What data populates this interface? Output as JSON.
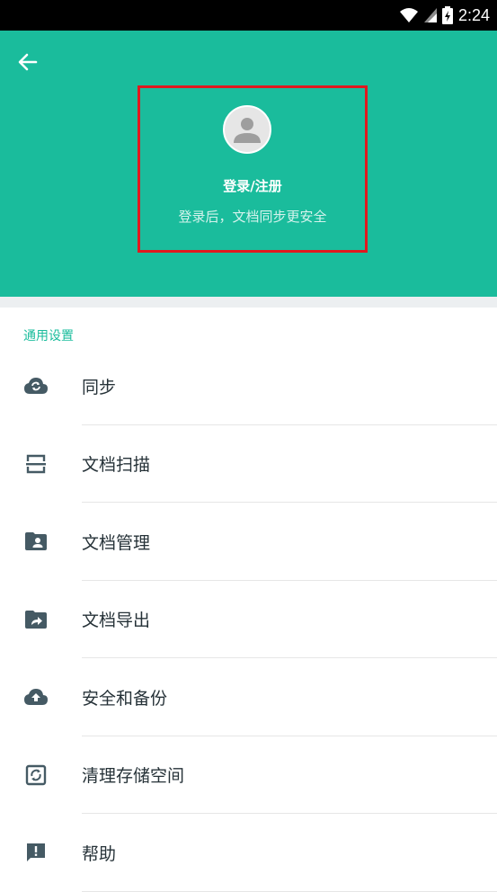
{
  "status_bar": {
    "time": "2:24"
  },
  "header": {
    "login_title": "登录/注册",
    "login_subtitle": "登录后，文档同步更安全",
    "accent_color": "#1ABC9C",
    "highlight_color": "#e0191f"
  },
  "settings": {
    "section_title": "通用设置",
    "items": [
      {
        "label": "同步",
        "icon": "cloud-sync-icon"
      },
      {
        "label": "文档扫描",
        "icon": "scan-icon"
      },
      {
        "label": "文档管理",
        "icon": "folder-account-icon"
      },
      {
        "label": "文档导出",
        "icon": "folder-share-icon"
      },
      {
        "label": "安全和备份",
        "icon": "cloud-upload-icon"
      },
      {
        "label": "清理存储空间",
        "icon": "cleanup-icon"
      },
      {
        "label": "帮助",
        "icon": "feedback-icon"
      }
    ]
  }
}
